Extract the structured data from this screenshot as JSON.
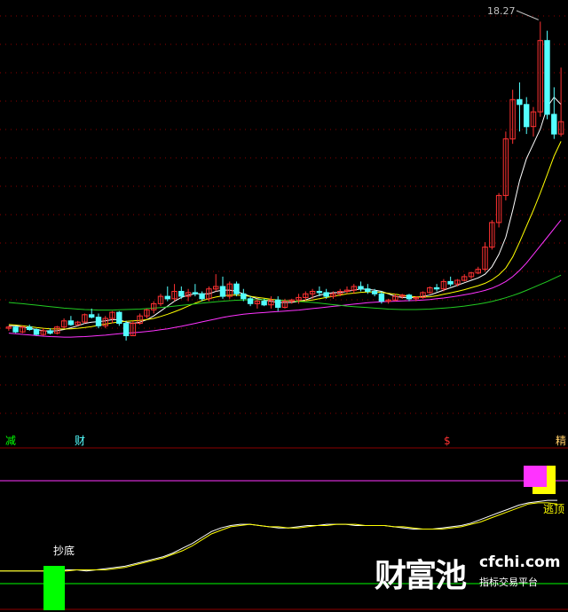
{
  "chart_data": [
    {
      "type": "candlestick",
      "price_label": "18.27",
      "ylim": [
        4.0,
        18.5
      ],
      "grid": true,
      "up_color": "#ff3232",
      "down_color": "#54ffff",
      "candles": [
        [
          5.8,
          5.9,
          5.7,
          5.85
        ],
        [
          5.85,
          5.9,
          5.6,
          5.65
        ],
        [
          5.65,
          5.9,
          5.6,
          5.85
        ],
        [
          5.85,
          5.95,
          5.7,
          5.75
        ],
        [
          5.75,
          5.8,
          5.5,
          5.55
        ],
        [
          5.55,
          5.8,
          5.5,
          5.7
        ],
        [
          5.7,
          5.8,
          5.55,
          5.6
        ],
        [
          5.6,
          5.9,
          5.55,
          5.85
        ],
        [
          5.85,
          6.2,
          5.8,
          6.1
        ],
        [
          6.1,
          6.3,
          5.9,
          5.95
        ],
        [
          5.95,
          6.1,
          5.9,
          6.05
        ],
        [
          6.05,
          6.4,
          6.0,
          6.35
        ],
        [
          6.35,
          6.6,
          6.2,
          6.25
        ],
        [
          6.25,
          6.4,
          5.8,
          5.9
        ],
        [
          5.9,
          6.3,
          5.8,
          6.2
        ],
        [
          6.2,
          6.5,
          6.0,
          6.45
        ],
        [
          6.45,
          6.5,
          5.9,
          6.0
        ],
        [
          6.0,
          6.1,
          5.3,
          5.5
        ],
        [
          5.5,
          6.1,
          5.5,
          6.0
        ],
        [
          6.0,
          6.4,
          5.95,
          6.3
        ],
        [
          6.3,
          6.6,
          6.2,
          6.55
        ],
        [
          6.55,
          6.9,
          6.4,
          6.8
        ],
        [
          6.8,
          7.2,
          6.7,
          7.1
        ],
        [
          7.1,
          7.5,
          6.9,
          7.0
        ],
        [
          7.0,
          7.6,
          6.9,
          7.3
        ],
        [
          7.3,
          7.5,
          7.0,
          7.1
        ],
        [
          7.1,
          7.4,
          6.9,
          7.25
        ],
        [
          7.25,
          7.6,
          7.1,
          7.2
        ],
        [
          7.2,
          7.3,
          6.9,
          7.0
        ],
        [
          7.0,
          7.5,
          6.9,
          7.4
        ],
        [
          7.4,
          8.0,
          7.3,
          7.5
        ],
        [
          7.5,
          7.9,
          7.0,
          7.1
        ],
        [
          7.1,
          7.7,
          7.0,
          7.6
        ],
        [
          7.6,
          7.7,
          7.1,
          7.2
        ],
        [
          7.2,
          7.4,
          6.9,
          7.0
        ],
        [
          7.0,
          7.1,
          6.7,
          6.8
        ],
        [
          6.8,
          7.0,
          6.6,
          6.9
        ],
        [
          6.9,
          7.0,
          6.7,
          6.75
        ],
        [
          6.75,
          7.1,
          6.6,
          6.95
        ],
        [
          6.95,
          7.1,
          6.5,
          6.65
        ],
        [
          6.65,
          7.0,
          6.6,
          6.9
        ],
        [
          6.9,
          7.0,
          6.8,
          6.95
        ],
        [
          6.95,
          7.2,
          6.8,
          7.05
        ],
        [
          7.05,
          7.3,
          6.9,
          7.2
        ],
        [
          7.2,
          7.4,
          7.0,
          7.3
        ],
        [
          7.3,
          7.5,
          7.1,
          7.25
        ],
        [
          7.25,
          7.4,
          7.0,
          7.1
        ],
        [
          7.1,
          7.3,
          7.0,
          7.2
        ],
        [
          7.2,
          7.4,
          7.1,
          7.3
        ],
        [
          7.3,
          7.5,
          7.2,
          7.35
        ],
        [
          7.35,
          7.6,
          7.2,
          7.5
        ],
        [
          7.5,
          7.7,
          7.3,
          7.4
        ],
        [
          7.4,
          7.6,
          7.2,
          7.3
        ],
        [
          7.3,
          7.4,
          7.1,
          7.2
        ],
        [
          7.2,
          7.3,
          6.8,
          6.9
        ],
        [
          6.9,
          7.0,
          6.8,
          6.95
        ],
        [
          6.95,
          7.2,
          6.9,
          7.1
        ],
        [
          7.1,
          7.2,
          7.0,
          7.15
        ],
        [
          7.15,
          7.2,
          6.9,
          7.0
        ],
        [
          7.0,
          7.1,
          6.9,
          7.05
        ],
        [
          7.05,
          7.3,
          7.0,
          7.25
        ],
        [
          7.25,
          7.5,
          7.2,
          7.45
        ],
        [
          7.45,
          7.6,
          7.3,
          7.4
        ],
        [
          7.4,
          7.8,
          7.3,
          7.7
        ],
        [
          7.7,
          7.9,
          7.5,
          7.6
        ],
        [
          7.6,
          7.8,
          7.5,
          7.75
        ],
        [
          7.75,
          8.0,
          7.7,
          7.9
        ],
        [
          7.9,
          8.1,
          7.8,
          8.05
        ],
        [
          8.05,
          8.3,
          8.0,
          8.2
        ],
        [
          8.2,
          9.3,
          8.1,
          9.1
        ],
        [
          9.1,
          10.2,
          9.0,
          10.1
        ],
        [
          10.1,
          11.3,
          9.9,
          11.2
        ],
        [
          11.2,
          13.8,
          11.0,
          13.5
        ],
        [
          13.5,
          15.5,
          13.3,
          15.1
        ],
        [
          15.1,
          15.8,
          13.8,
          14.9
        ],
        [
          14.9,
          15.2,
          13.7,
          14.0
        ],
        [
          14.0,
          14.8,
          13.6,
          14.6
        ],
        [
          14.6,
          18.27,
          14.4,
          17.5
        ],
        [
          17.5,
          17.9,
          14.3,
          14.5
        ],
        [
          14.5,
          15.6,
          13.5,
          13.7
        ],
        [
          13.7,
          16.4,
          13.6,
          14.2
        ]
      ],
      "ma_lines": [
        {
          "color": "#ffffff",
          "values": [
            5.9,
            5.9,
            5.85,
            5.8,
            5.75,
            5.7,
            5.68,
            5.7,
            5.75,
            5.82,
            5.9,
            6.0,
            6.05,
            6.07,
            6.1,
            6.15,
            6.15,
            6.05,
            6.0,
            6.05,
            6.15,
            6.3,
            6.5,
            6.7,
            6.9,
            7.05,
            7.15,
            7.2,
            7.2,
            7.2,
            7.3,
            7.35,
            7.35,
            7.3,
            7.2,
            7.1,
            7.0,
            6.95,
            6.9,
            6.85,
            6.85,
            6.85,
            6.9,
            6.95,
            7.05,
            7.15,
            7.2,
            7.25,
            7.25,
            7.3,
            7.35,
            7.4,
            7.38,
            7.35,
            7.3,
            7.2,
            7.1,
            7.05,
            7.05,
            7.05,
            7.1,
            7.15,
            7.25,
            7.35,
            7.45,
            7.55,
            7.65,
            7.75,
            7.85,
            8.0,
            8.3,
            8.8,
            9.5,
            10.6,
            11.8,
            12.7,
            13.3,
            13.9,
            14.8,
            15.2,
            14.9
          ]
        },
        {
          "color": "#ffff00",
          "values": [
            5.95,
            5.93,
            5.9,
            5.87,
            5.83,
            5.8,
            5.78,
            5.77,
            5.77,
            5.78,
            5.8,
            5.83,
            5.87,
            5.92,
            5.97,
            6.02,
            6.06,
            6.08,
            6.1,
            6.12,
            6.15,
            6.2,
            6.28,
            6.37,
            6.47,
            6.58,
            6.7,
            6.82,
            6.92,
            7.0,
            7.07,
            7.12,
            7.15,
            7.15,
            7.13,
            7.1,
            7.06,
            7.02,
            6.98,
            6.95,
            6.92,
            6.9,
            6.9,
            6.92,
            6.95,
            7.0,
            7.05,
            7.1,
            7.15,
            7.2,
            7.23,
            7.26,
            7.28,
            7.28,
            7.26,
            7.22,
            7.18,
            7.14,
            7.1,
            7.08,
            7.07,
            7.08,
            7.12,
            7.18,
            7.24,
            7.3,
            7.37,
            7.45,
            7.53,
            7.63,
            7.77,
            7.97,
            8.25,
            8.7,
            9.3,
            9.95,
            10.6,
            11.3,
            12.05,
            12.8,
            13.4
          ]
        },
        {
          "color": "#ff33ff",
          "values": [
            5.6,
            5.58,
            5.55,
            5.53,
            5.5,
            5.48,
            5.46,
            5.45,
            5.44,
            5.44,
            5.45,
            5.46,
            5.48,
            5.5,
            5.52,
            5.55,
            5.58,
            5.6,
            5.62,
            5.64,
            5.67,
            5.7,
            5.74,
            5.78,
            5.83,
            5.88,
            5.94,
            6.0,
            6.06,
            6.12,
            6.18,
            6.24,
            6.29,
            6.33,
            6.37,
            6.4,
            6.42,
            6.44,
            6.46,
            6.48,
            6.5,
            6.52,
            6.54,
            6.57,
            6.6,
            6.63,
            6.66,
            6.69,
            6.72,
            6.75,
            6.78,
            6.81,
            6.84,
            6.86,
            6.88,
            6.89,
            6.9,
            6.91,
            6.92,
            6.93,
            6.95,
            6.97,
            7.0,
            7.03,
            7.07,
            7.11,
            7.16,
            7.21,
            7.27,
            7.34,
            7.43,
            7.55,
            7.7,
            7.9,
            8.15,
            8.45,
            8.8,
            9.15,
            9.5,
            9.85,
            10.2
          ]
        },
        {
          "color": "#22cc22",
          "values": [
            6.85,
            6.82,
            6.8,
            6.77,
            6.74,
            6.71,
            6.68,
            6.65,
            6.62,
            6.6,
            6.58,
            6.56,
            6.55,
            6.54,
            6.54,
            6.54,
            6.55,
            6.56,
            6.57,
            6.58,
            6.6,
            6.62,
            6.64,
            6.67,
            6.7,
            6.73,
            6.76,
            6.79,
            6.82,
            6.85,
            6.88,
            6.9,
            6.92,
            6.94,
            6.95,
            6.96,
            6.96,
            6.96,
            6.95,
            6.94,
            6.93,
            6.91,
            6.89,
            6.87,
            6.85,
            6.82,
            6.79,
            6.76,
            6.73,
            6.7,
            6.68,
            6.66,
            6.64,
            6.62,
            6.6,
            6.58,
            6.57,
            6.56,
            6.56,
            6.56,
            6.57,
            6.58,
            6.6,
            6.62,
            6.64,
            6.67,
            6.7,
            6.74,
            6.78,
            6.83,
            6.89,
            6.96,
            7.04,
            7.13,
            7.23,
            7.34,
            7.46,
            7.58,
            7.7,
            7.83,
            7.96
          ]
        }
      ]
    },
    {
      "type": "line",
      "ylim": [
        0,
        100
      ],
      "series": [
        {
          "color": "#ffffff",
          "values": [
            12,
            12,
            12,
            12,
            12,
            12,
            12,
            13,
            13,
            12,
            13,
            14,
            15,
            16,
            18,
            20,
            22,
            24,
            27,
            31,
            35,
            40,
            45,
            48,
            50,
            51,
            51,
            50,
            49,
            48,
            48,
            49,
            50,
            50,
            51,
            51,
            51,
            50,
            50,
            50,
            50,
            49,
            48,
            47,
            47,
            47,
            48,
            49,
            50,
            52,
            55,
            58,
            61,
            64,
            67,
            69,
            70,
            71,
            71
          ]
        },
        {
          "color": "#ffff00",
          "values": [
            12,
            12,
            12,
            12,
            12,
            12,
            12,
            12,
            13,
            13,
            13,
            13,
            14,
            15,
            17,
            19,
            21,
            23,
            26,
            29,
            33,
            38,
            43,
            46,
            49,
            50,
            51,
            50,
            49,
            49,
            48,
            48,
            49,
            50,
            50,
            51,
            51,
            51,
            50,
            50,
            50,
            49,
            49,
            48,
            47,
            47,
            47,
            48,
            49,
            51,
            53,
            56,
            59,
            62,
            65,
            68,
            69,
            69,
            68
          ]
        }
      ],
      "signals": [
        {
          "label": "抄底",
          "color": "#00ff00"
        },
        {
          "label": "逃顶",
          "color": "#ffff00"
        }
      ]
    }
  ],
  "markers": {
    "m1": "减",
    "m2": "财",
    "m3": "$",
    "m4": "精"
  },
  "watermark": {
    "brand_cn": "财富池",
    "brand_en": "cfchi.com",
    "slogan": "指标交易平台"
  }
}
